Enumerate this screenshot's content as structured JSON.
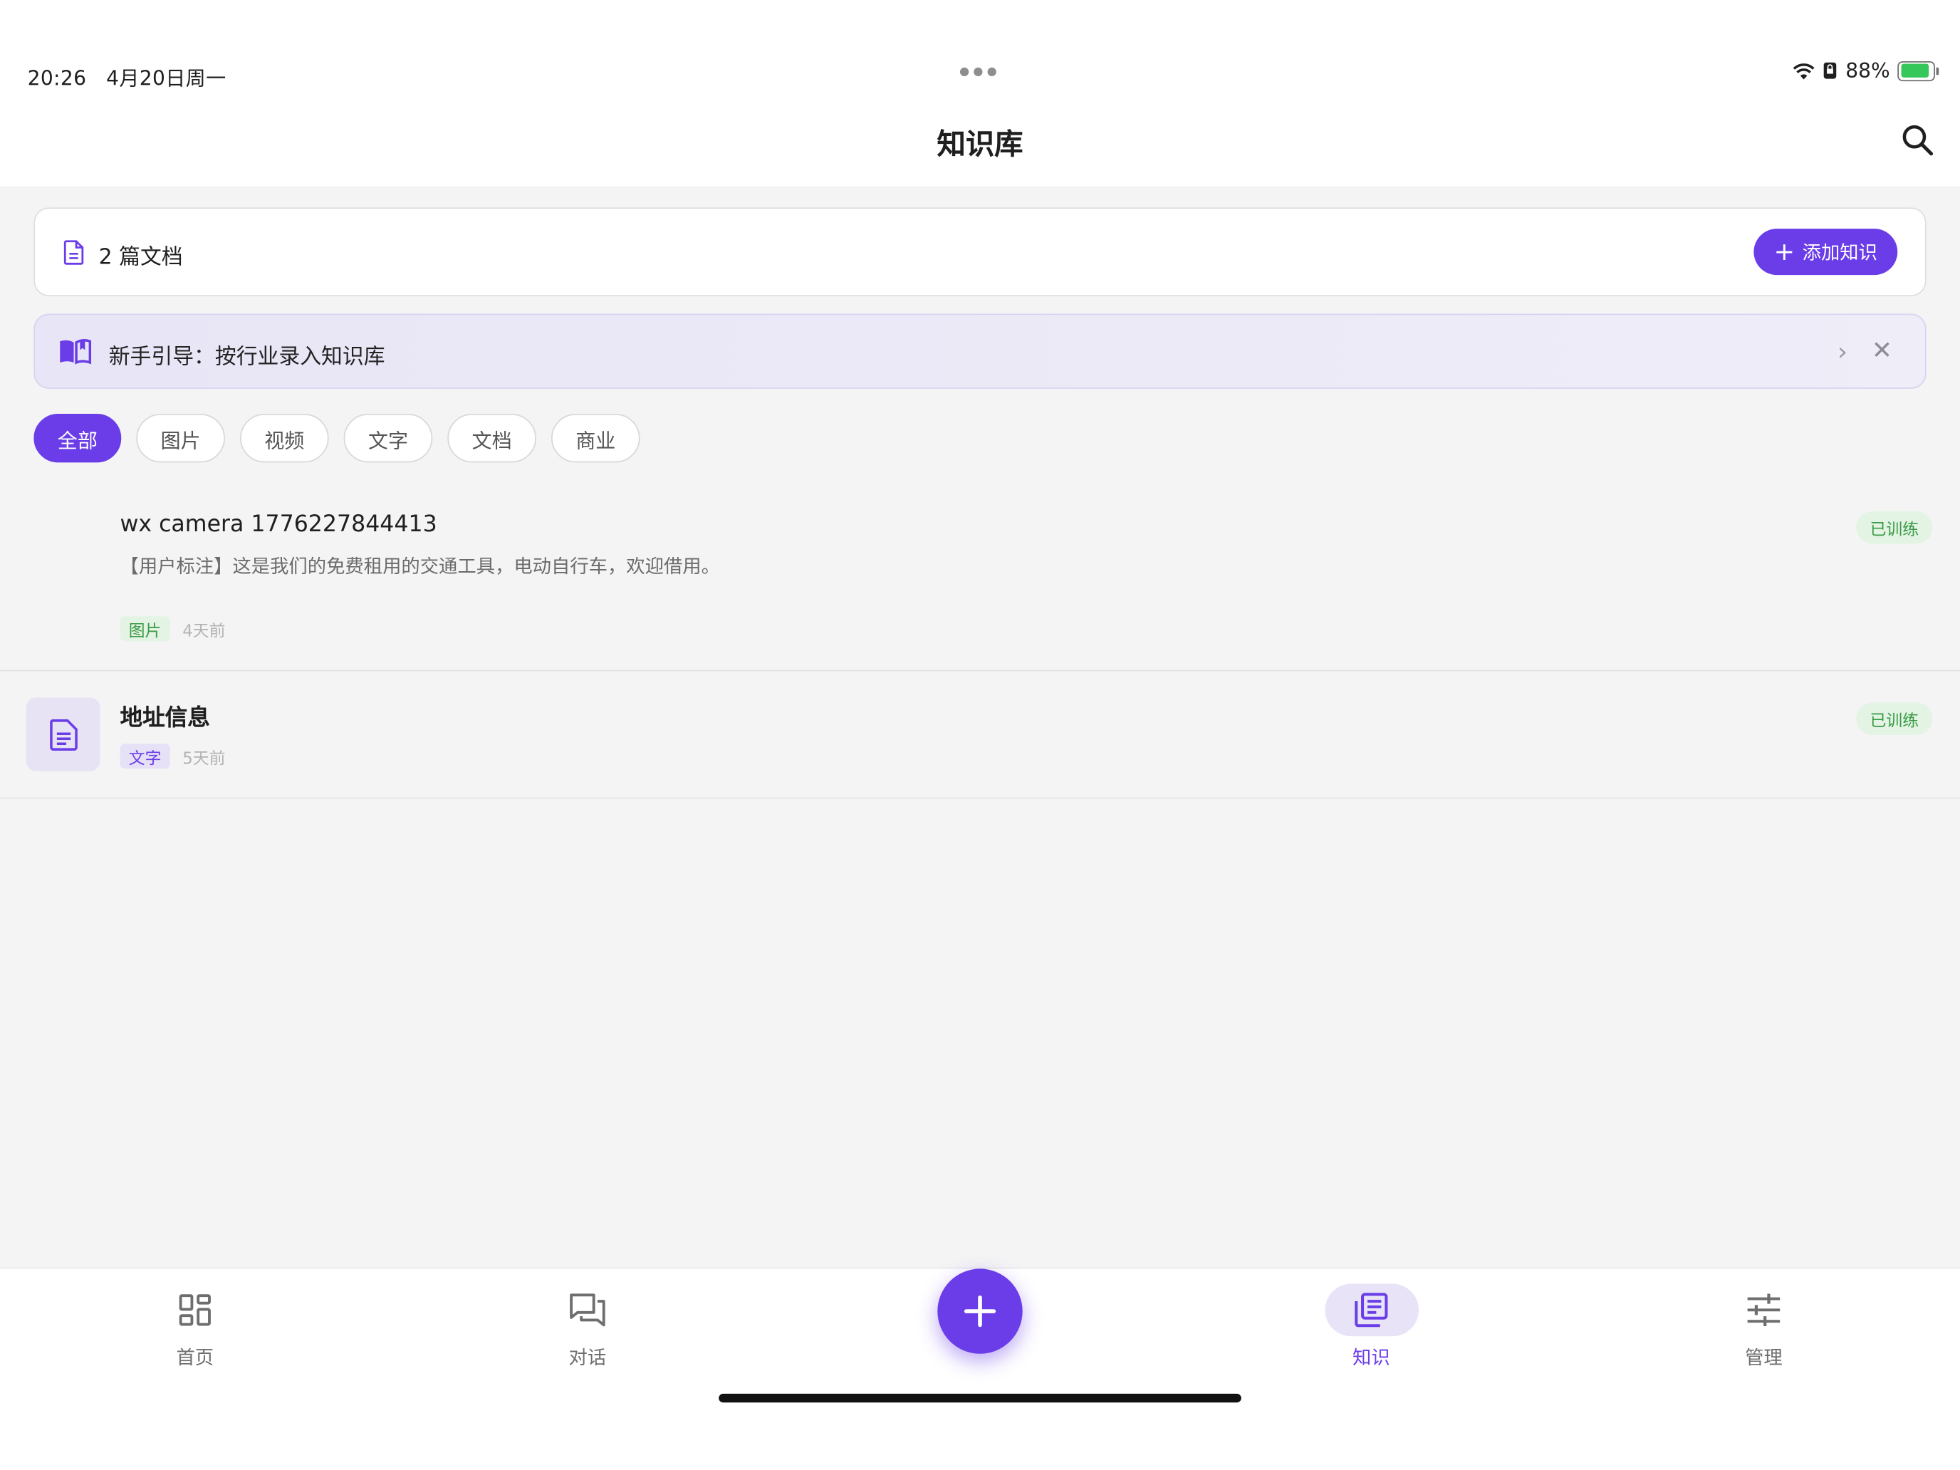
{
  "status_bar": {
    "time": "20:26",
    "date": "4月20日周一",
    "battery": "88%",
    "battery_level": 0.88,
    "battery_color": "#35c759"
  },
  "header": {
    "title": "知识库",
    "search_icon": "search-icon"
  },
  "summary": {
    "doc_count_text": "2 篇文档",
    "add_button_label": "添加知识",
    "accent_color": "#6a3de8"
  },
  "guide": {
    "text": "新手引导：按行业录入知识库",
    "icon": "open-book-icon"
  },
  "filters": {
    "selected": "全部",
    "items": [
      "全部",
      "图片",
      "视频",
      "文字",
      "文档",
      "商业"
    ]
  },
  "documents": [
    {
      "title": "wx camera 1776227844413",
      "description": "【用户标注】这是我们的免费租用的交通工具，电动自行车，欢迎借用。",
      "type_tag": "图片",
      "time": "4天前",
      "status": "已训练"
    },
    {
      "title": "地址信息",
      "description": "",
      "type_tag": "文字",
      "time": "5天前",
      "status": "已训练",
      "icon": "document-icon"
    }
  ],
  "bottom_nav": {
    "items": [
      {
        "label": "首页",
        "icon": "dashboard-icon"
      },
      {
        "label": "对话",
        "icon": "chat-icon"
      },
      {
        "label": "知识",
        "icon": "library-icon"
      },
      {
        "label": "管理",
        "icon": "sliders-icon"
      }
    ],
    "active": "知识",
    "fab_icon": "plus-icon"
  }
}
